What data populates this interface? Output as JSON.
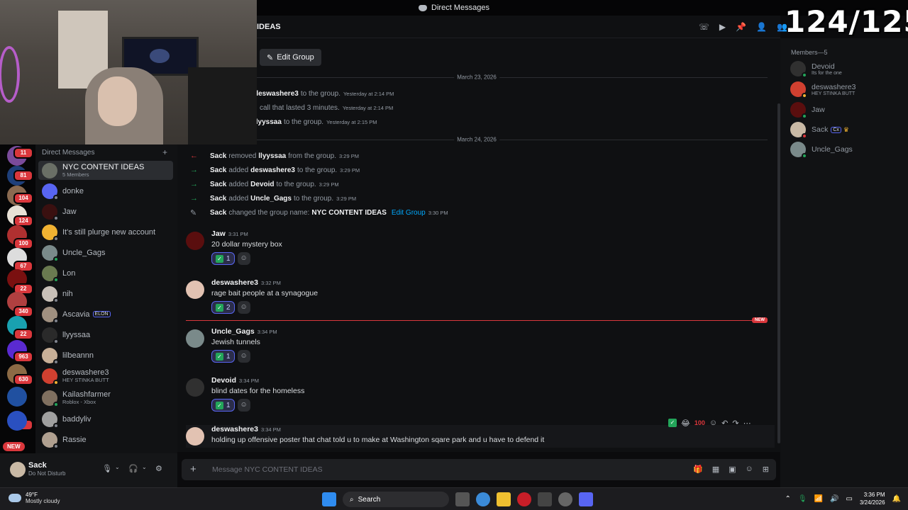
{
  "window": {
    "title": "Direct Messages"
  },
  "overlay": {
    "counter": "124/125"
  },
  "channel": {
    "title": "NYC CONTENT IDEAS",
    "title_visible": "IDEAS",
    "edit_group_label": "Edit Group"
  },
  "rail": {
    "badges": [
      "11",
      "81",
      "104",
      "124",
      "100",
      "67",
      "22",
      "340",
      "22",
      "963",
      "630",
      "27"
    ],
    "new_label": "NEW"
  },
  "dm_list": {
    "header": "Direct Messages",
    "items": [
      {
        "name": "NYC CONTENT IDEAS",
        "sub": "5 Members"
      },
      {
        "name": "donke"
      },
      {
        "name": "Jaw"
      },
      {
        "name": "It's still plurge new account"
      },
      {
        "name": "Uncle_Gags"
      },
      {
        "name": "Lon"
      },
      {
        "name": "nih"
      },
      {
        "name": "Ascavia",
        "tag": "ELON"
      },
      {
        "name": "llyyssaa"
      },
      {
        "name": "lilbeannn"
      },
      {
        "name": "deswashere3",
        "sub": "HEY STINKA BUTT"
      },
      {
        "name": "Kailashfarmer",
        "sub": "Roblox - Xbox"
      },
      {
        "name": "baddyliv"
      },
      {
        "name": "Rassie"
      }
    ]
  },
  "user": {
    "name": "Sack",
    "status": "Do Not Disturb"
  },
  "top_partial": {
    "line1_name": "deswashere3",
    "line1_text": "to the group.",
    "line1_time": "Yesterday at 2:14 PM",
    "line2_text": "call that lasted 3 minutes.",
    "line2_time": "Yesterday at 2:14 PM",
    "line3_name": "llyyssaa",
    "line3_text": "to the group.",
    "line3_time": "Yesterday at 2:15 PM"
  },
  "dates": {
    "d1": "March 23, 2026",
    "d2": "March 24, 2026"
  },
  "system": [
    {
      "actor": "Sack",
      "verb": "removed",
      "target": "llyyssaa",
      "rest": "from the group.",
      "time": "3:29 PM"
    },
    {
      "actor": "Sack",
      "verb": "added",
      "target": "deswashere3",
      "rest": "to the group.",
      "time": "3:29 PM"
    },
    {
      "actor": "Sack",
      "verb": "added",
      "target": "Devoid",
      "rest": "to the group.",
      "time": "3:29 PM"
    },
    {
      "actor": "Sack",
      "verb": "added",
      "target": "Uncle_Gags",
      "rest": "to the group.",
      "time": "3:29 PM"
    },
    {
      "actor": "Sack",
      "verb": "changed the group name:",
      "target": "NYC CONTENT IDEAS",
      "rest": "Edit Group",
      "time": "3:30 PM"
    }
  ],
  "messages": [
    {
      "author": "Jaw",
      "time": "3:31 PM",
      "text": "20 dollar mystery box",
      "reaction_count": "1"
    },
    {
      "author": "deswashere3",
      "time": "3:32 PM",
      "text": "rage bait people at a synagogue",
      "reaction_count": "2"
    },
    {
      "author": "Uncle_Gags",
      "time": "3:34 PM",
      "text": "Jewish tunnels",
      "reaction_count": "1"
    },
    {
      "author": "Devoid",
      "time": "3:34 PM",
      "text": "blind dates for the homeless",
      "reaction_count": "1"
    },
    {
      "author": "deswashere3",
      "time": "3:34 PM",
      "text": "holding up offensive poster that chat told u to make  at Washington sqare park and u have to defend it"
    }
  ],
  "new_marker": "NEW",
  "composer": {
    "placeholder": "Message NYC CONTENT IDEAS"
  },
  "members": {
    "header": "Members—5",
    "list": [
      {
        "name": "Devoid",
        "sub": "Its for the one"
      },
      {
        "name": "deswashere3",
        "sub": "HEY STINKA BUTT"
      },
      {
        "name": "Jaw"
      },
      {
        "name": "Sack",
        "tag": "Cx"
      },
      {
        "name": "Uncle_Gags"
      }
    ]
  },
  "taskbar": {
    "weather_temp": "49°F",
    "weather_desc": "Mostly cloudy",
    "search_label": "Search",
    "time": "3:36 PM",
    "date": "3/24/2026"
  }
}
